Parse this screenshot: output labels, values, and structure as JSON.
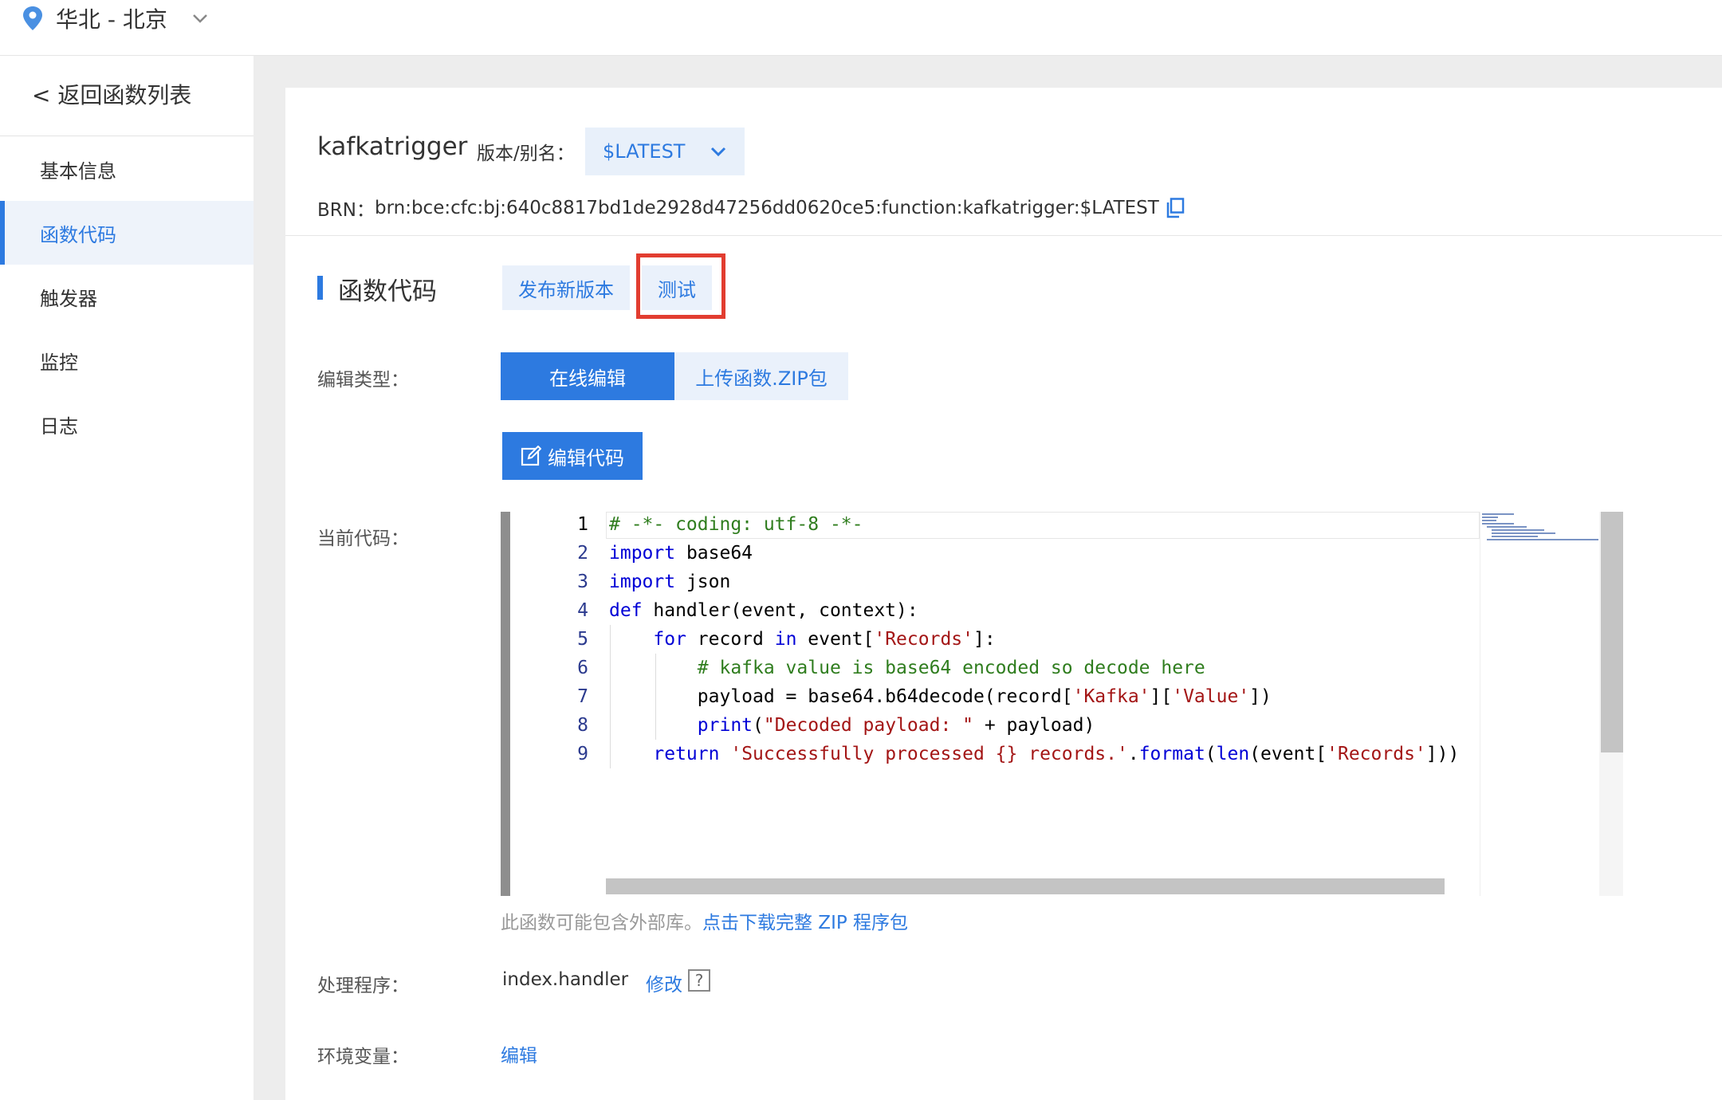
{
  "region": {
    "label": "华北 - 北京",
    "pin_icon": "location-pin-icon",
    "chevron_icon": "chevron-down-icon"
  },
  "sidebar": {
    "back_label": "< 返回函数列表",
    "items": [
      {
        "label": "基本信息",
        "active": false
      },
      {
        "label": "函数代码",
        "active": true
      },
      {
        "label": "触发器",
        "active": false
      },
      {
        "label": "监控",
        "active": false
      },
      {
        "label": "日志",
        "active": false
      }
    ]
  },
  "function": {
    "name": "kafkatrigger",
    "version_label": "版本/别名：",
    "version_value": "$LATEST",
    "brn_label": "BRN：",
    "brn_value": "brn:bce:cfc:bj:640c8817bd1de2928d47256dd0620ce5:function:kafkatrigger:$LATEST"
  },
  "section": {
    "title": "函数代码",
    "publish_label": "发布新版本",
    "test_label": "测试"
  },
  "edit_type": {
    "label": "编辑类型：",
    "online_label": "在线编辑",
    "zip_label": "上传函数.ZIP包"
  },
  "edit_code_label": "编辑代码",
  "current_code": {
    "label": "当前代码：",
    "line_numbers": [
      "1",
      "2",
      "3",
      "4",
      "5",
      "6",
      "7",
      "8",
      "9"
    ],
    "lines": [
      "# -*- coding: utf-8 -*-",
      "import base64",
      "import json",
      "def handler(event, context):",
      "    for record in event['Records']:",
      "        # kafka value is base64 encoded so decode here",
      "        payload = base64.b64decode(record['Kafka']['Value'])",
      "        print(\"Decoded payload: \" + payload)",
      "    return 'Successfully processed {} records.'.format(len(event['Records']))"
    ]
  },
  "hint": {
    "text": "此函数可能包含外部库。",
    "link": "点击下载完整 ZIP 程序包"
  },
  "handler": {
    "label": "处理程序：",
    "value": "index.handler",
    "modify_label": "修改",
    "help_label": "?"
  },
  "env": {
    "label": "环境变量：",
    "edit_label": "编辑"
  },
  "colors": {
    "accent": "#2d7ae0",
    "highlight_box": "#e23d30"
  }
}
